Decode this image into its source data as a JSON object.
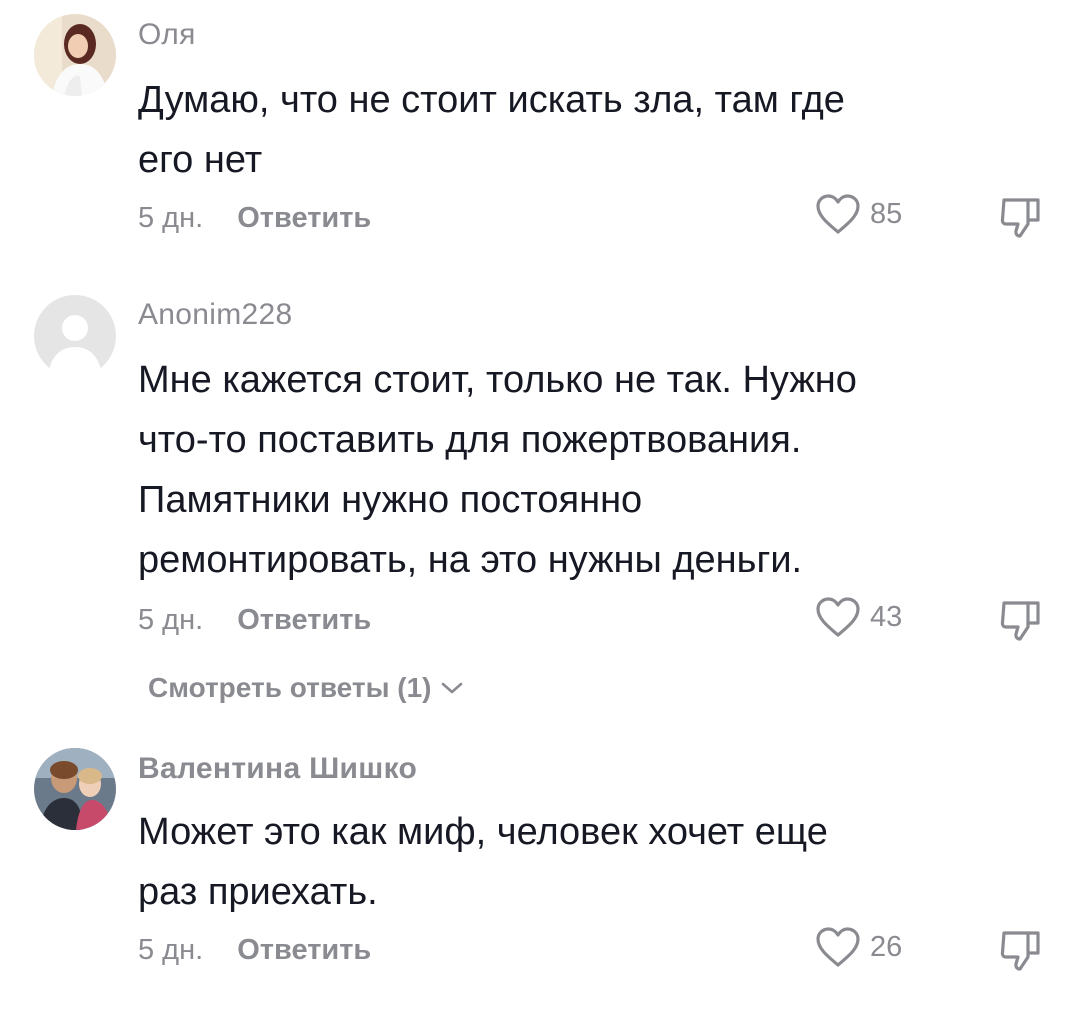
{
  "comments": [
    {
      "username": "Оля",
      "text_lines": [
        "Думаю, что не стоит искать зла, там где",
        "его нет"
      ],
      "time": "5 дн.",
      "reply_label": "Ответить",
      "likes": "85"
    },
    {
      "username": "Anonim228",
      "text_lines": [
        "Мне кажется стоит, только не так. Нужно",
        "что-то поставить для пожертвования.",
        "Памятники нужно постоянно",
        "ремонтировать, на это нужны деньги."
      ],
      "time": "5 дн.",
      "reply_label": "Ответить",
      "likes": "43",
      "view_replies": "Смотреть ответы (1)"
    },
    {
      "username": "Валентина Шишко",
      "text_lines": [
        "Может это как миф, человек хочет еще",
        "раз приехать."
      ],
      "time": "5 дн.",
      "reply_label": "Ответить",
      "likes": "26"
    }
  ],
  "colors": {
    "text": "#161823",
    "secondary": "#8a8b91",
    "background": "#ffffff"
  },
  "icons": {
    "like": "heart-outline-icon",
    "dislike": "thumbs-down-outline-icon",
    "expand": "chevron-down-icon"
  }
}
